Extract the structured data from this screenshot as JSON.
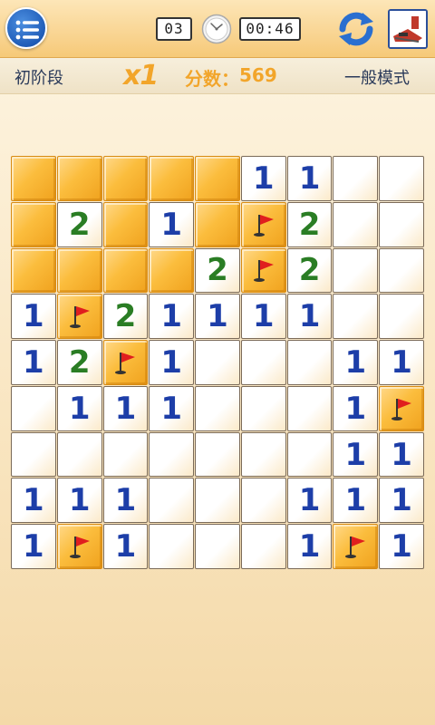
{
  "header": {
    "mine_counter": "03",
    "timer": "00:46",
    "icons": {
      "menu": "menu-icon",
      "clock": "clock-icon",
      "refresh": "refresh-icon",
      "theme": "theme-icon"
    }
  },
  "status": {
    "level": "初阶段",
    "multiplier": "x1",
    "score_label": "分数：",
    "score_value": "569",
    "mode": "一般模式"
  },
  "board": {
    "rows": 9,
    "cols": 9,
    "cells": [
      [
        "H",
        "H",
        "H",
        "H",
        "H",
        "1",
        "1",
        "",
        ""
      ],
      [
        "H",
        "2",
        "H",
        "1",
        "H",
        "F",
        "2",
        "",
        ""
      ],
      [
        "H",
        "H",
        "H",
        "H",
        "2",
        "F",
        "2",
        "",
        ""
      ],
      [
        "1",
        "F",
        "2",
        "1",
        "1",
        "1",
        "1",
        "",
        ""
      ],
      [
        "1",
        "2",
        "F",
        "1",
        "",
        "",
        "",
        "1",
        "1"
      ],
      [
        "",
        "1",
        "1",
        "1",
        "",
        "",
        "",
        "1",
        "F"
      ],
      [
        "",
        "",
        "",
        "",
        "",
        "",
        "",
        "1",
        "1"
      ],
      [
        "1",
        "1",
        "1",
        "",
        "",
        "",
        "1",
        "1",
        "1"
      ],
      [
        "1",
        "F",
        "1",
        "",
        "",
        "",
        "1",
        "F",
        "1"
      ]
    ]
  },
  "colors": {
    "number_1": "#1d3ea8",
    "number_2": "#2a7d24",
    "hidden_tile": "#fbbd3d",
    "accent": "#f2a52a",
    "menu_blue": "#1f5cb8"
  }
}
